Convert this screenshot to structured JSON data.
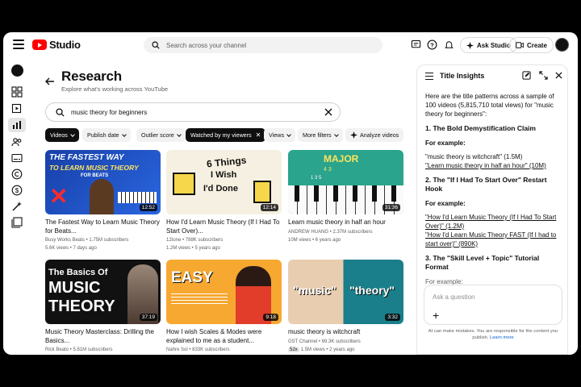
{
  "header": {
    "logo_text": "Studio",
    "search_placeholder": "Search across your channel",
    "ask_studio_label": "Ask Studio",
    "create_label": "Create"
  },
  "page": {
    "title": "Research",
    "subtitle": "Explore what's working across YouTube",
    "query": "music theory for beginners"
  },
  "filters": [
    {
      "label": "Videos",
      "active": true
    },
    {
      "label": "Publish date",
      "active": false
    },
    {
      "label": "Outlier score",
      "active": false
    },
    {
      "label": "Watched by my viewers",
      "active": true
    },
    {
      "label": "Views",
      "active": false
    },
    {
      "label": "More filters",
      "active": false
    },
    {
      "label": "Analyze videos",
      "active": false
    }
  ],
  "videos": [
    {
      "title_l1": "The Fastest Way to Learn Music Theory",
      "title_l2": "for Beats...",
      "channel": "Busy Works Beats",
      "subs": "1.75M subscribers",
      "stats": "5.6K views • 7 days ago",
      "duration": "12:52",
      "thumb_text_1": "THE FASTEST WAY",
      "thumb_text_2": "TO LEARN MUSIC THEORY",
      "thumb_text_3": "FOR BEATS"
    },
    {
      "title_l1": "How I'd Learn Music Theory (If I Had To",
      "title_l2": "Start Over)...",
      "channel": "12tone",
      "subs": "788K subscribers",
      "stats": "1.2M views • 5 years ago",
      "duration": "12:14",
      "thumb_text_1": "6 Things",
      "thumb_text_2": "I Wish",
      "thumb_text_3": "I'd Done"
    },
    {
      "title_l1": "Learn music theory in half an hour",
      "title_l2": "",
      "channel": "ANDREW HUANG",
      "subs": "2.37M subscribers",
      "stats": "10M views • 6 years ago",
      "duration": "31:36",
      "thumb_text_1": "MAJOR",
      "thumb_text_2": "4 3",
      "thumb_text_3": "1 3 5"
    },
    {
      "title_l1": "Music Theory Masterclass: Drilling the",
      "title_l2": "Basics...",
      "channel": "Rick Beato",
      "subs": "5.81M subscribers",
      "stats": "",
      "duration": "37:19",
      "thumb_text_1": "The Basics Of",
      "thumb_text_2": "MUSIC",
      "thumb_text_3": "THEORY"
    },
    {
      "title_l1": "How I wish Scales & Modes were",
      "title_l2": "explained to me as a student...",
      "channel": "Nahre Sol",
      "subs": "833K subscribers",
      "stats": "",
      "duration": "9:18",
      "thumb_text_1": "EASY",
      "thumb_text_2": "",
      "thumb_text_3": ""
    },
    {
      "title_l1": "music theory is witchcraft",
      "title_l2": "",
      "channel": "GST Channel",
      "subs": "69.3K subscribers",
      "stats": "1.5M views • 2 years ago",
      "badge": "52x",
      "duration": "3:32",
      "thumb_text_1": "\"music\"",
      "thumb_text_2": "\"theory\"",
      "thumb_text_3": ""
    }
  ],
  "panel": {
    "title": "Title Insights",
    "intro": "Here are the title patterns across a sample of 100 videos (5,815,710 total views) for \"music theory for beginners\":",
    "section1": "1. The Bold Demystification Claim",
    "for_example": "For example:",
    "s1_ex1": "\"music theory is witchcraft\" (1.5M)",
    "s1_ex2": "\"Learn music theory in half an hour\" (10M)",
    "section2": "2. The \"If I Had To Start Over\" Restart Hook",
    "s2_ex1": "\"How I'd Learn Music Theory (If I Had To Start Over)\" (1.2M)",
    "s2_ex2": "\"How I'd Learn Music Theory FAST (If I had to start over)\" (890K)",
    "section3": "3. The \"Skill Level + Topic\" Tutorial Format",
    "ask_placeholder": "Ask a question",
    "disclaimer": "AI can make mistakes. You are responsible for the content you publish.",
    "learn_more": "Learn more"
  },
  "colors": {
    "brand_red": "#ff0000",
    "link_blue": "#065fd4"
  }
}
